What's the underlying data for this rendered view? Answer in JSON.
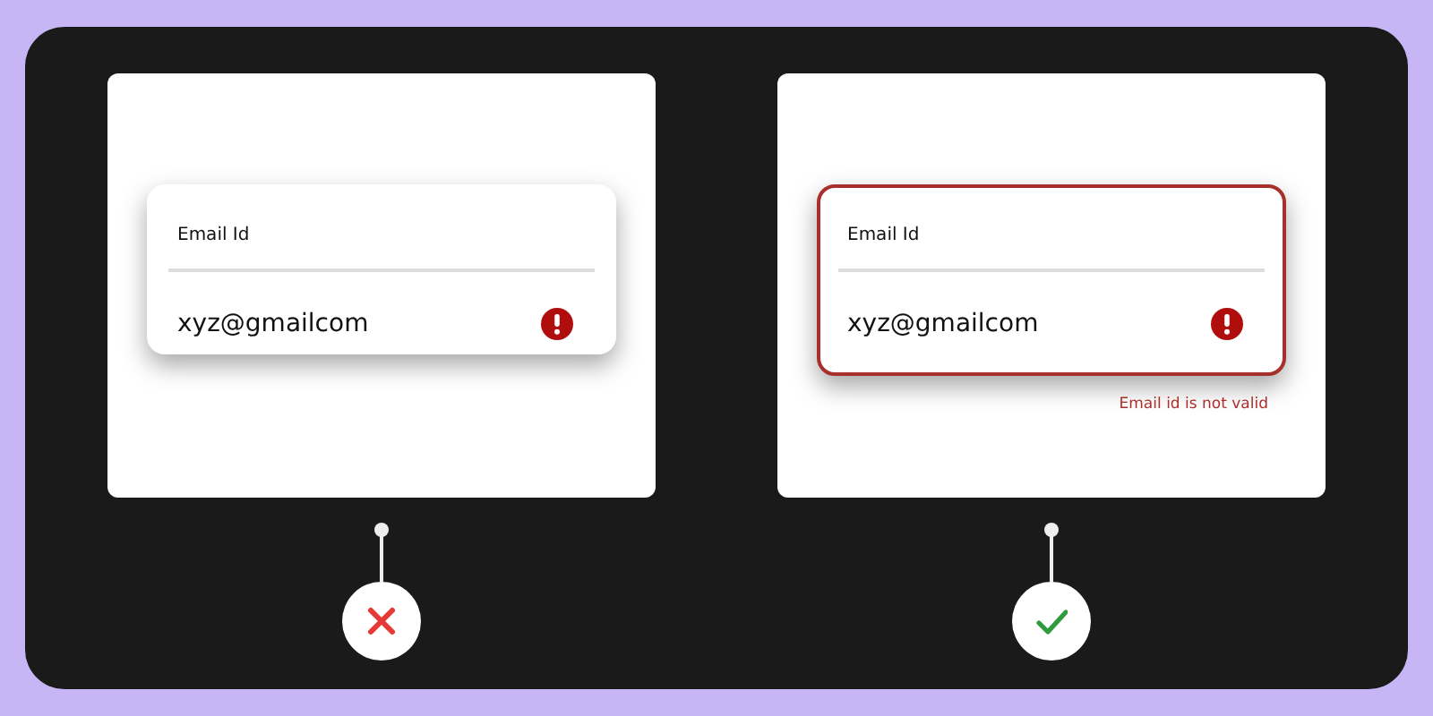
{
  "examples": [
    {
      "kind": "wrong",
      "field": {
        "label": "Email Id",
        "value": "xyz@gmailcom",
        "invalid": false
      }
    },
    {
      "kind": "right",
      "field": {
        "label": "Email Id",
        "value": "xyz@gmailcom",
        "invalid": true
      },
      "error_message": "Email id is not valid"
    }
  ]
}
